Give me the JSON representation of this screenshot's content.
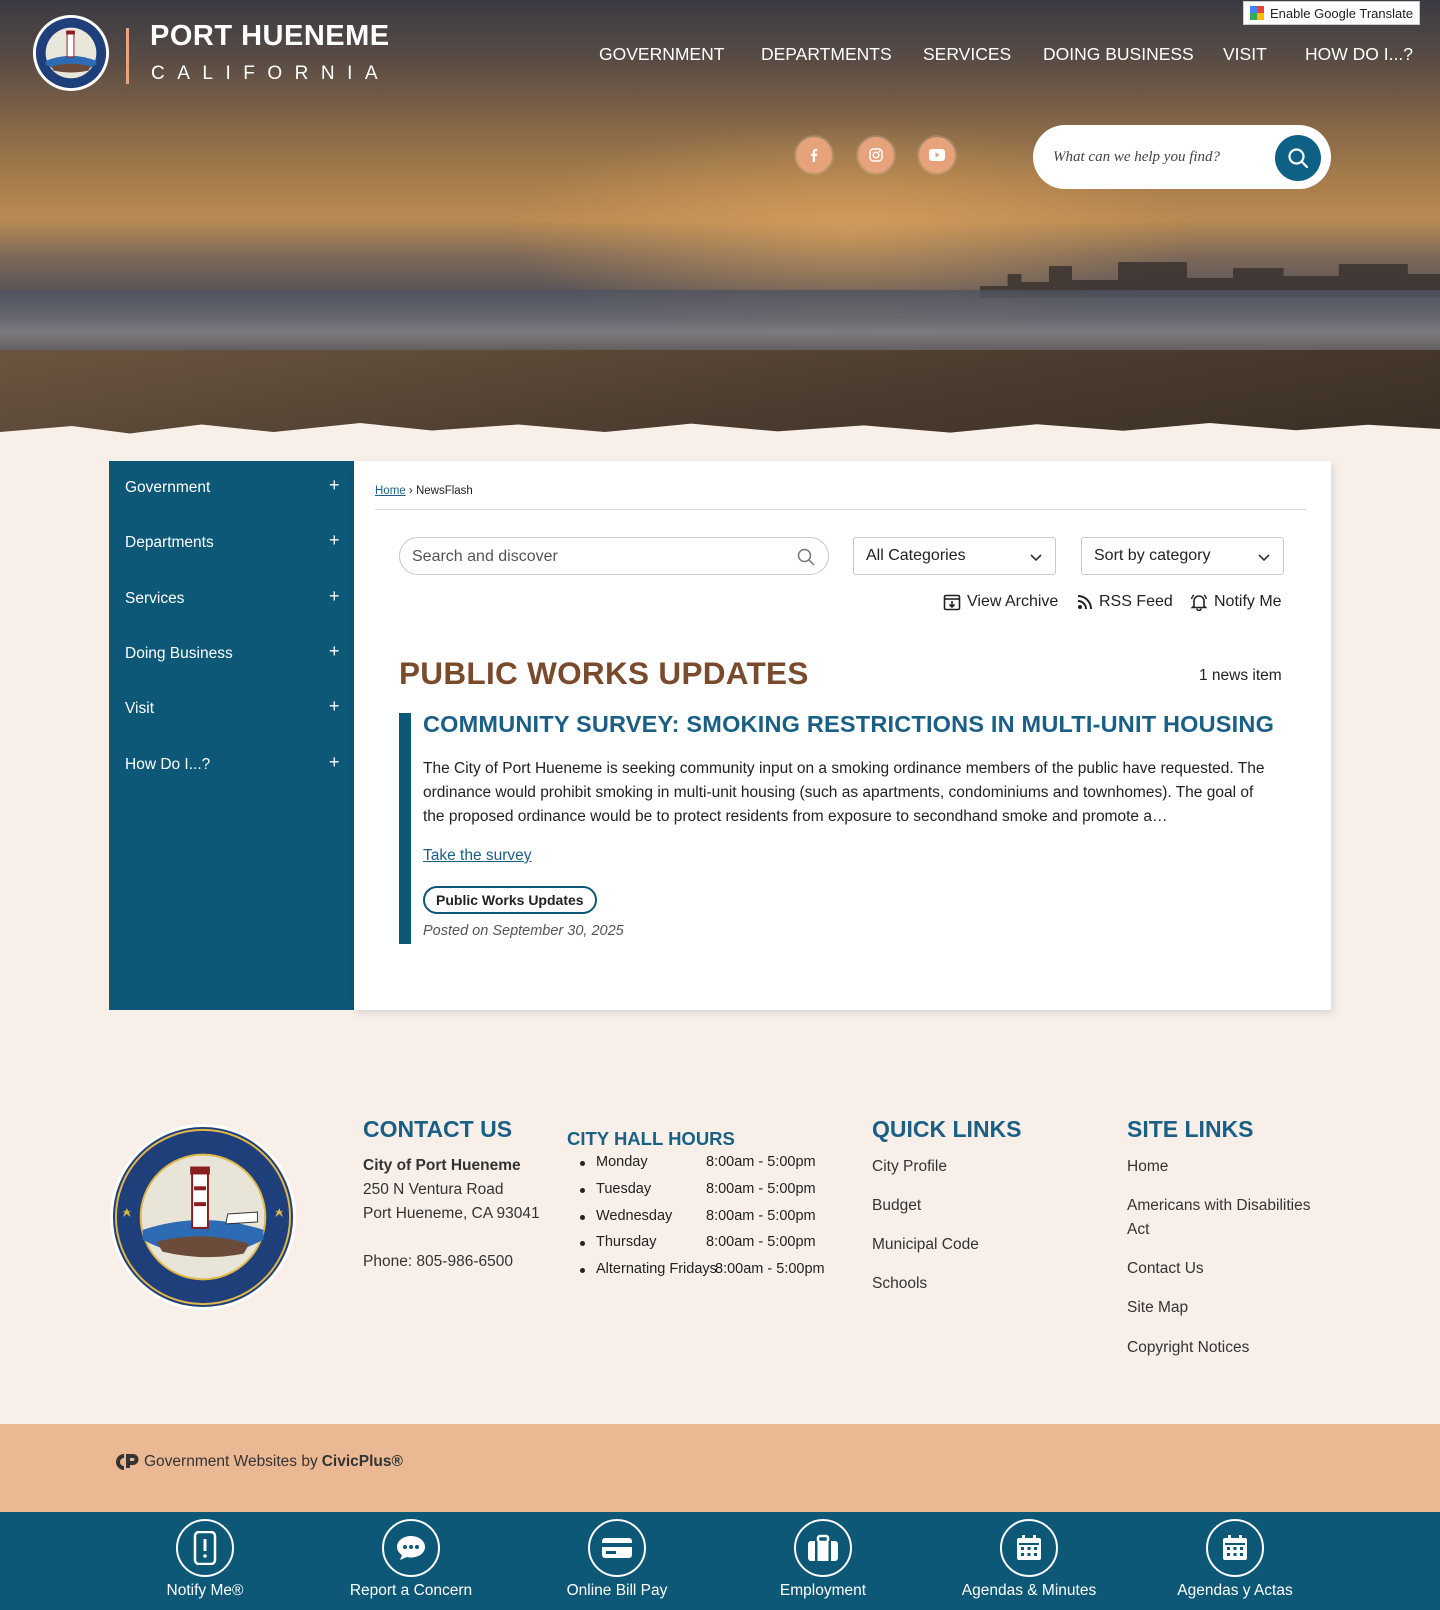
{
  "header": {
    "city_name": "PORT HUENEME",
    "state": "CALIFORNIA",
    "translate_label": "Enable Google Translate",
    "nav": [
      "GOVERNMENT",
      "DEPARTMENTS",
      "SERVICES",
      "DOING BUSINESS",
      "VISIT",
      "HOW DO I...?"
    ],
    "search_placeholder": "What can we help you find?",
    "social": [
      "facebook-icon",
      "instagram-icon",
      "youtube-icon"
    ]
  },
  "sidebar": {
    "items": [
      {
        "label": "Government"
      },
      {
        "label": "Departments"
      },
      {
        "label": "Services"
      },
      {
        "label": "Doing Business"
      },
      {
        "label": "Visit"
      },
      {
        "label": "How Do I...?"
      }
    ],
    "expand_symbol": "+"
  },
  "breadcrumb": {
    "home": "Home",
    "separator": "›",
    "current": "NewsFlash"
  },
  "filters": {
    "search_placeholder": "Search and discover",
    "category": "All Categories",
    "sort": "Sort by category"
  },
  "tools": {
    "archive": "View Archive",
    "rss": "RSS Feed",
    "notify": "Notify Me"
  },
  "section": {
    "title": "PUBLIC WORKS UPDATES",
    "count": "1 news item"
  },
  "article": {
    "title": "COMMUNITY SURVEY: SMOKING RESTRICTIONS IN MULTI-UNIT HOUSING",
    "body": "The City of Port Hueneme is seeking community input on a smoking ordinance members of the public have requested.  The ordinance would prohibit smoking in multi-unit housing (such as apartments, condominiums and townhomes). The goal of the proposed ordinance would be to protect residents from exposure to secondhand smoke and promote a…",
    "link": "Take the survey",
    "tag": "Public Works Updates",
    "posted": "Posted on September 30, 2025"
  },
  "footer": {
    "contact": {
      "heading": "CONTACT US",
      "name": "City of Port Hueneme",
      "address1": "250 N Ventura Road",
      "address2": "Port Hueneme, CA 93041",
      "phone": "Phone: 805-986-6500"
    },
    "hours": {
      "heading": "CITY HALL HOURS",
      "rows": [
        {
          "day": "Monday",
          "time": "8:00am - 5:00pm"
        },
        {
          "day": "Tuesday",
          "time": "8:00am - 5:00pm"
        },
        {
          "day": "Wednesday",
          "time": "8:00am - 5:00pm"
        },
        {
          "day": "Thursday",
          "time": "8:00am - 5:00pm"
        },
        {
          "day": "Alternating Fridays",
          "time": "8:00am - 5:00pm"
        }
      ]
    },
    "quick_links": {
      "heading": "QUICK LINKS",
      "items": [
        "City Profile",
        "Budget",
        "Municipal Code",
        "Schools"
      ]
    },
    "site_links": {
      "heading": "SITE LINKS",
      "items": [
        "Home",
        "Americans with Disabilities",
        "Act",
        "Contact Us",
        "Site Map",
        "Copyright Notices"
      ]
    },
    "civicplus": {
      "prefix": "Government Websites by",
      "brand": "CivicPlus®"
    }
  },
  "quick_actions": [
    "Notify Me®",
    "Report a Concern",
    "Online Bill Pay",
    "Employment",
    "Agendas & Minutes",
    "Agendas y Actas"
  ],
  "colors": {
    "primary": "#0d5876",
    "link": "#1a5f85",
    "accent": "#e6a27a",
    "title_brown": "#7a4a2c",
    "background": "#f8efe9",
    "band": "#ebb894"
  }
}
